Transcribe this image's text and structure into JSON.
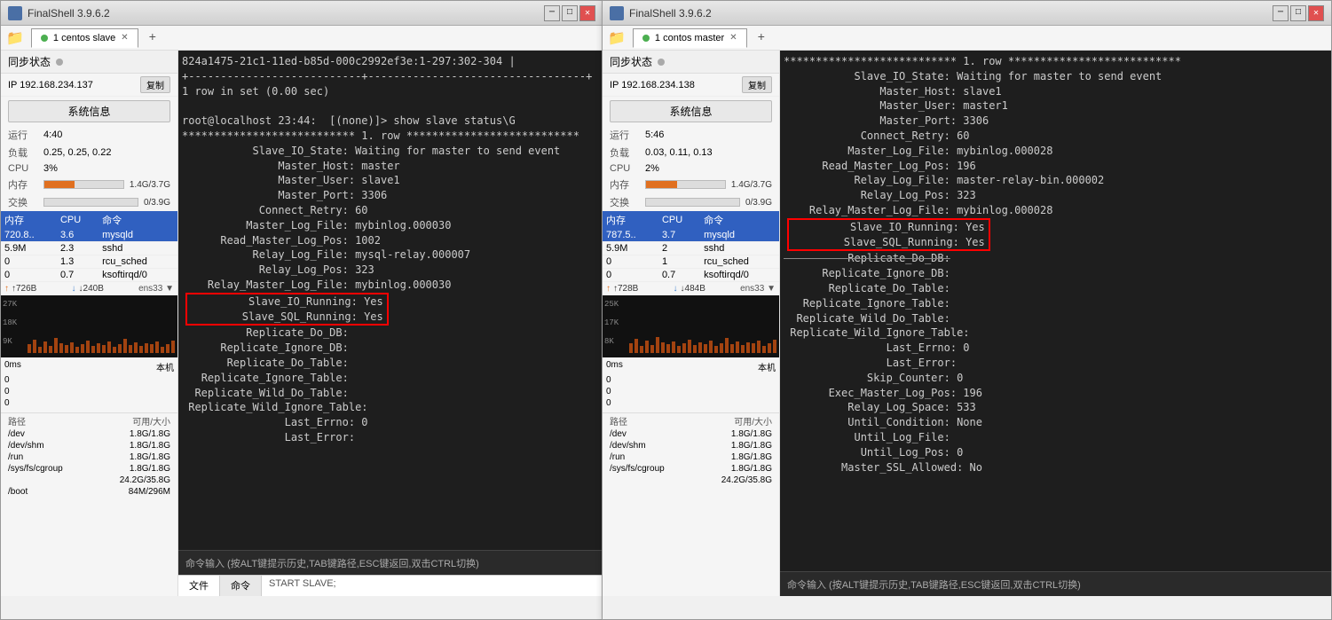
{
  "window1": {
    "title": "FinalShell 3.9.6.2",
    "tab": "1 centos slave",
    "sync_status": "同步状态",
    "ip": "192.168.234.137",
    "copy_label": "复制",
    "sys_info_btn": "系统信息",
    "uptime_label": "运行",
    "uptime_val": "4:40",
    "load_label": "负载",
    "load_val": "0.25, 0.25, 0.22",
    "cpu_label": "CPU",
    "cpu_val": "3%",
    "mem_label": "内存",
    "mem_val": "38%",
    "mem_size": "1.4G/3.7G",
    "swap_label": "交换",
    "swap_val": "0%",
    "swap_size": "0/3.9G",
    "mem_pct": 38,
    "swap_pct": 0,
    "process_cols": [
      "内存",
      "CPU",
      "命令"
    ],
    "processes": [
      {
        "mem": "720.8..",
        "cpu": "3.6",
        "cmd": "mysqld"
      },
      {
        "mem": "5.9M",
        "cpu": "2.3",
        "cmd": "sshd"
      },
      {
        "mem": "0",
        "cpu": "1.3",
        "cmd": "rcu_sched"
      },
      {
        "mem": "0",
        "cpu": "0.7",
        "cmd": "ksoftirqd/0"
      }
    ],
    "net_up_label": "↑726B",
    "net_down_label": "↓240B",
    "net_interface": "ens33 ▼",
    "chart_y_labels": [
      "27K",
      "18K",
      "9K"
    ],
    "latency_label": "0ms",
    "latency_right": "本机",
    "latency_vals": [
      "0",
      "0",
      "0"
    ],
    "disk_header_path": "路径",
    "disk_header_size": "可用/大小",
    "disks": [
      {
        "path": "/dev",
        "size": "1.8G/1.8G"
      },
      {
        "path": "/dev/shm",
        "size": "1.8G/1.8G"
      },
      {
        "path": "/run",
        "size": "1.8G/1.8G"
      },
      {
        "path": "/sys/fs/cgroup",
        "size": "1.8G/1.8G"
      },
      {
        "path": "",
        "size": "24.2G/35.8G"
      },
      {
        "path": "/boot",
        "size": "84M/296M"
      }
    ],
    "terminal_content": "824a1475-21c1-11ed-b85d-000c2992ef3e:1-297:302-304 |\n+---------------------------+----------------------------------+\n1 row in set (0.00 sec)\n\nroot@localhost 23:44:  [(none)]> show slave status\\G\n*************************** 1. row ***************************\n           Slave_IO_State: Waiting for master to send event\n               Master_Host: master\n               Master_User: slave1\n               Master_Port: 3306\n            Connect_Retry: 60\n          Master_Log_File: mybinlog.000030\n      Read_Master_Log_Pos: 1002\n           Relay_Log_File: mysql-relay.000007\n            Relay_Log_Pos: 323\n    Relay_Master_Log_File: mybinlog.000030\n         Slave_IO_Running: Yes\n        Slave_SQL_Running: Yes\n          Replicate_Do_DB:\n      Replicate_Ignore_DB:\n       Replicate_Do_Table:\n   Replicate_Ignore_Table:\n  Replicate_Wild_Do_Table:\n Replicate_Wild_Ignore_Table:\n                Last_Errno: 0\n                Last_Error:\n",
    "highlighted_lines": [
      "         Slave_IO_Running: Yes",
      "        Slave_SQL_Running: Yes"
    ],
    "cmd_input_hint": "命令输入 (按ALT键提示历史,TAB键路径,ESC键返回,双击CTRL切换)",
    "bottom_tabs": [
      "文件",
      "命令"
    ],
    "start_slave_hint": "START SLAVE;"
  },
  "window2": {
    "title": "FinalShell 3.9.6.2",
    "tab": "1 contos master",
    "sync_status": "同步状态",
    "ip": "192.168.234.138",
    "copy_label": "复制",
    "sys_info_btn": "系统信息",
    "uptime_label": "运行",
    "uptime_val": "5:46",
    "load_label": "负载",
    "load_val": "0.03, 0.11, 0.13",
    "cpu_label": "CPU",
    "cpu_val": "2%",
    "mem_label": "内存",
    "mem_val": "39%",
    "mem_size": "1.4G/3.7G",
    "swap_label": "交换",
    "swap_val": "0%",
    "swap_size": "0/3.9G",
    "mem_pct": 39,
    "swap_pct": 0,
    "process_cols": [
      "内存",
      "CPU",
      "命令"
    ],
    "processes": [
      {
        "mem": "787.5..",
        "cpu": "3.7",
        "cmd": "mysqld"
      },
      {
        "mem": "5.9M",
        "cpu": "2",
        "cmd": "sshd"
      },
      {
        "mem": "0",
        "cpu": "1",
        "cmd": "rcu_sched"
      },
      {
        "mem": "0",
        "cpu": "0.7",
        "cmd": "ksoftirqd/0"
      }
    ],
    "net_up_label": "↑728B",
    "net_down_label": "↓484B",
    "net_interface": "ens33 ▼",
    "chart_y_labels": [
      "25K",
      "17K",
      "8K"
    ],
    "latency_label": "0ms",
    "latency_right": "本机",
    "latency_vals": [
      "0",
      "0",
      "0"
    ],
    "disk_header_path": "路径",
    "disk_header_size": "可用/大小",
    "disks": [
      {
        "path": "/dev",
        "size": "1.8G/1.8G"
      },
      {
        "path": "/dev/shm",
        "size": "1.8G/1.8G"
      },
      {
        "path": "/run",
        "size": "1.8G/1.8G"
      },
      {
        "path": "/sys/fs/cgroup",
        "size": "1.8G/1.8G"
      },
      {
        "path": "",
        "size": "24.2G/35.8G"
      }
    ],
    "terminal_content_pre": "*************************** 1. row ***************************\n           Slave_IO_State: Waiting for master to send event\n               Master_Host: slave1\n               Master_User: master1\n               Master_Port: 3306\n            Connect_Retry: 60\n          Master_Log_File: mybinlog.000028\n      Read_Master_Log_Pos: 196\n           Relay_Log_File: master-relay-bin.000002\n            Relay_Log_Pos: 323\n    Relay_Master_Log_File: mybinlog.000028\n",
    "highlighted_lines": [
      "         Slave_IO_Running: Yes",
      "        Slave_SQL_Running: Yes"
    ],
    "terminal_content_post": "          Replicate_Do_DB:\n      Replicate_Ignore_DB:\n       Replicate_Do_Table:\n   Replicate_Ignore_Table:\n  Replicate_Wild_Do_Table:\n Replicate_Wild_Ignore_Table:\n                Last_Errno: 0\n                Last_Error:\n             Skip_Counter: 0\n       Exec_Master_Log_Pos: 196\n          Relay_Log_Space: 533\n          Until_Condition: None\n           Until_Log_File:\n            Until_Log_Pos: 0\n         Master_SSL_Allowed: No\n",
    "cmd_input_hint": "命令输入 (按ALT键提示历史,TAB键路径,ESC键返回,双击CTRL切换)"
  }
}
